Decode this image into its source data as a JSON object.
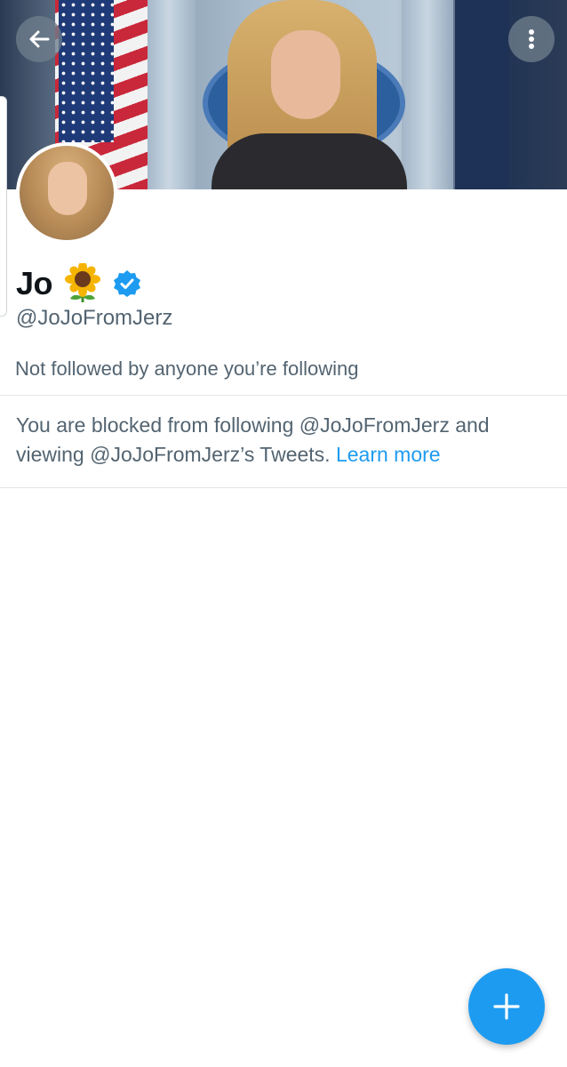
{
  "profile": {
    "display_name": "Jo",
    "handle": "@JoJoFromJerz",
    "followed_by_text": "Not followed by anyone you’re following"
  },
  "blocked_notice": {
    "part1": "You are blocked from following @JoJoFromJerz and viewing @JoJoFromJerz’s Tweets.",
    "learn_more": "Learn more"
  },
  "icons": {
    "back": "back-arrow-icon",
    "more": "more-vertical-icon",
    "verified": "verified-badge-icon",
    "sunflower": "sunflower-emoji-icon",
    "compose": "plus-icon"
  },
  "colors": {
    "accent": "#1d9bf0",
    "secondary_text": "#536471",
    "primary_text": "#0f1419"
  }
}
